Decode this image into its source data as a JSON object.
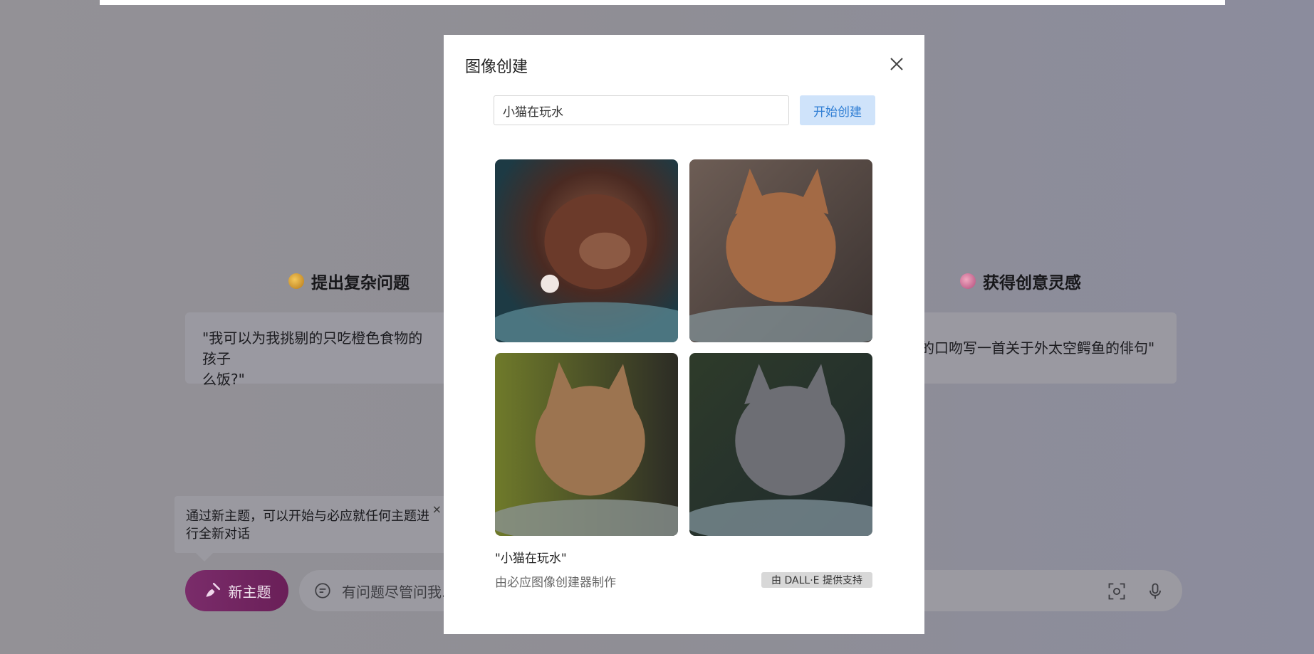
{
  "background": {
    "left_category": {
      "title": "提出复杂问题",
      "icon": "thinking-face-icon"
    },
    "right_category": {
      "title": "获得创意灵感",
      "icon": "palette-icon"
    },
    "left_card": {
      "line1": "\"我可以为我挑剔的只吃橙色食物的孩子",
      "line2": "么饭?\""
    },
    "right_card": {
      "text": "的口吻写一首关于外太空鳄鱼的俳句\""
    },
    "tooltip": {
      "line1": "通过新主题，可以开始与必应就任何主题进",
      "line2": "行全新对话",
      "close": "×"
    },
    "new_topic_label": "新主题",
    "chat_placeholder": "有问题尽管问我..."
  },
  "modal": {
    "title": "图像创建",
    "prompt_value": "小猫在玩水",
    "create_button": "开始创建",
    "caption": "\"小猫在玩水\"",
    "subcaption": "由必应图像创建器制作",
    "badge": "由 DALL·E 提供支持"
  },
  "colors": {
    "accent": "#2f7ed4",
    "new_topic": "#7a2c6a"
  }
}
